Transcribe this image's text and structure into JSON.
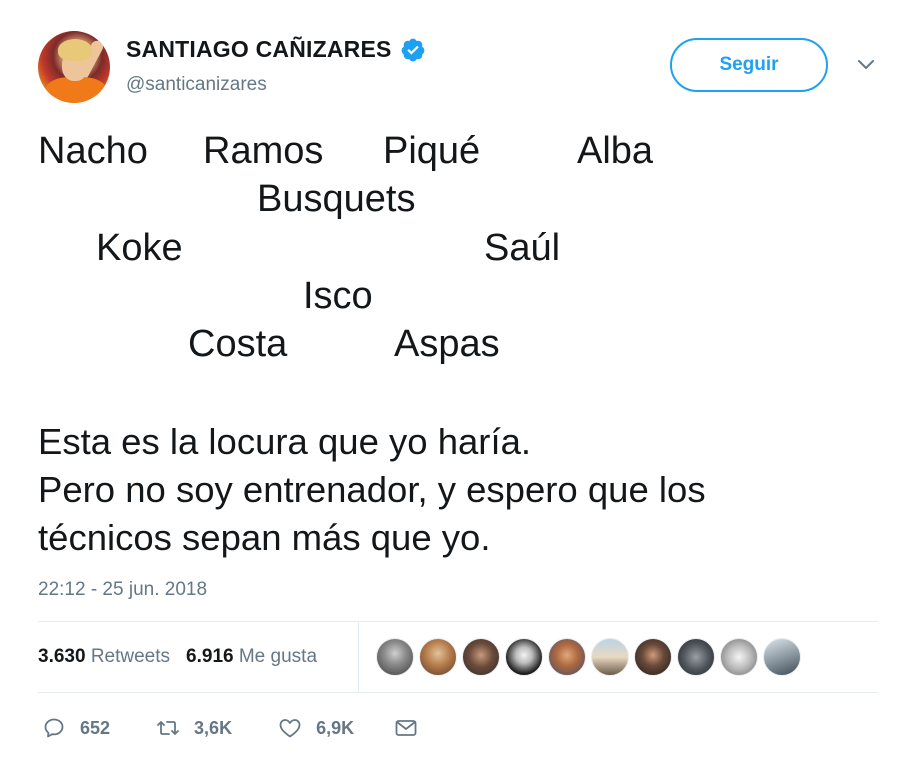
{
  "author": {
    "display_name": "SANTIAGO CAÑIZARES",
    "handle": "@santicanizares",
    "verified": true
  },
  "follow_button": {
    "label": "Seguir"
  },
  "lineup": {
    "row1": [
      "Nacho",
      "Ramos",
      "Piqué",
      "Alba"
    ],
    "row2": [
      "Busquets"
    ],
    "row3": [
      "Koke",
      "Saúl"
    ],
    "row4": [
      "Isco"
    ],
    "row5": [
      "Costa",
      "Aspas"
    ]
  },
  "text_lines": [
    "Esta es la locura que yo haría.",
    "Pero no soy entrenador, y espero que los",
    "técnicos sepan más que yo."
  ],
  "timestamp": "22:12 - 25 jun. 2018",
  "stats": {
    "retweets_count": "3.630",
    "retweets_label": "Retweets",
    "likes_count": "6.916",
    "likes_label": "Me gusta"
  },
  "actions": {
    "replies": "652",
    "retweets": "3,6K",
    "likes": "6,9K"
  },
  "colors": {
    "accent": "#1da1f2",
    "secondary_text": "#657786",
    "primary_text": "#14171a",
    "divider": "#e6ecf0"
  },
  "icons": [
    "verified-badge-icon",
    "chevron-down-icon",
    "reply-icon",
    "retweet-icon",
    "heart-icon",
    "direct-message-icon"
  ]
}
